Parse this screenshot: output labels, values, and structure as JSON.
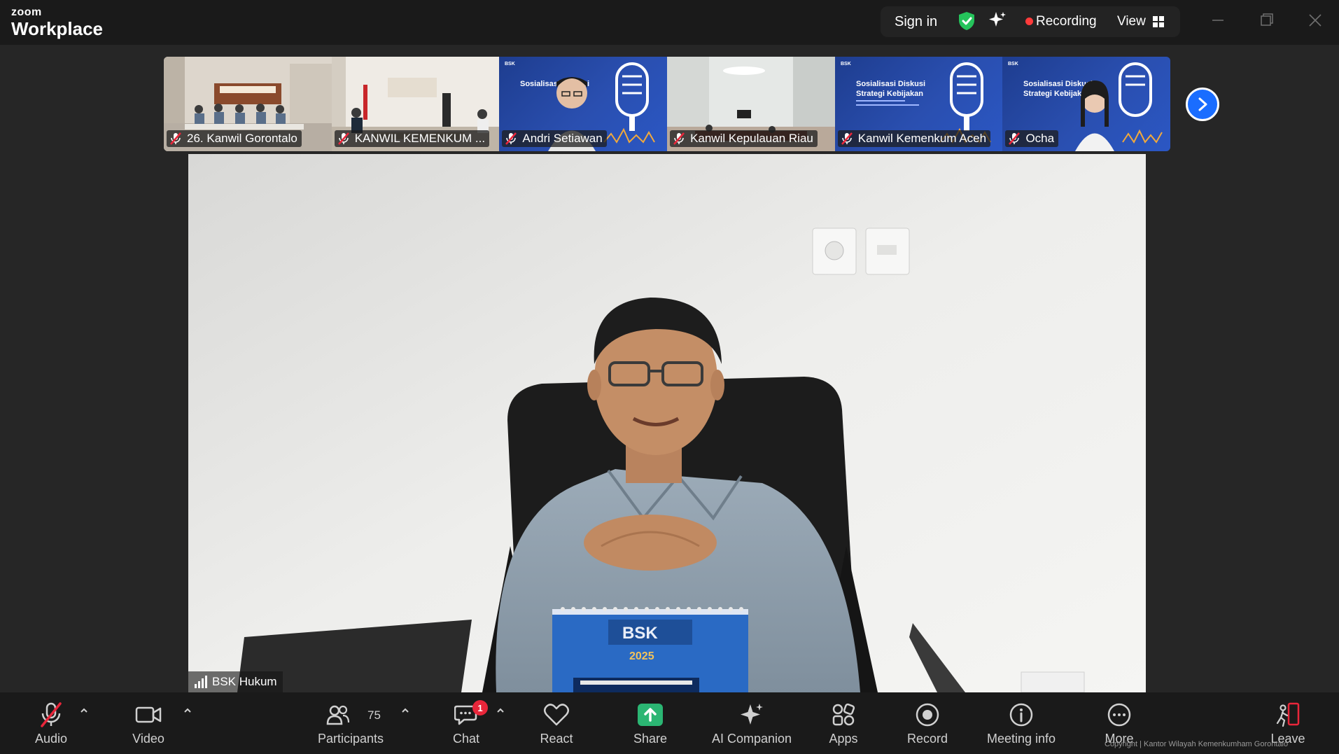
{
  "app": {
    "brand_small": "zoom",
    "brand_big": "Workplace"
  },
  "topbar": {
    "sign_in": "Sign in",
    "recording": "Recording",
    "view": "View"
  },
  "thumbnails": [
    {
      "name": "26. Kanwil Gorontalo",
      "muted": true
    },
    {
      "name": "KANWIL KEMENKUM ...",
      "muted": true
    },
    {
      "name": "Andri Setiawan",
      "muted": true
    },
    {
      "name": "Kanwil Kepulauan Riau",
      "muted": true
    },
    {
      "name": "Kanwil Kemenkum Aceh",
      "muted": true
    },
    {
      "name": "Ocha",
      "muted": true
    }
  ],
  "slide_text": {
    "logo": "BSK",
    "title_line1": "Sosialisasi Diskusi",
    "title_line2": "Strategi Kebijakan"
  },
  "main_video": {
    "speaker": "BSK Hukum",
    "calendar_logo": "BSK",
    "calendar_year": "2025"
  },
  "toolbar": {
    "audio": "Audio",
    "video": "Video",
    "participants": "Participants",
    "participants_count": "75",
    "chat": "Chat",
    "chat_badge": "1",
    "react": "React",
    "share": "Share",
    "ai_companion": "AI Companion",
    "apps": "Apps",
    "record": "Record",
    "meeting_info": "Meeting info",
    "more": "More",
    "leave": "Leave"
  },
  "overlay": {
    "copyright": "Copyright | Kantor Wilayah Kemenkumham Gorontalo"
  },
  "colors": {
    "accent": "#1a6dff",
    "share_green": "#2bb673",
    "record_red": "#ff3b3b",
    "shield_green": "#25c35b",
    "mute_red": "#e8263a"
  }
}
